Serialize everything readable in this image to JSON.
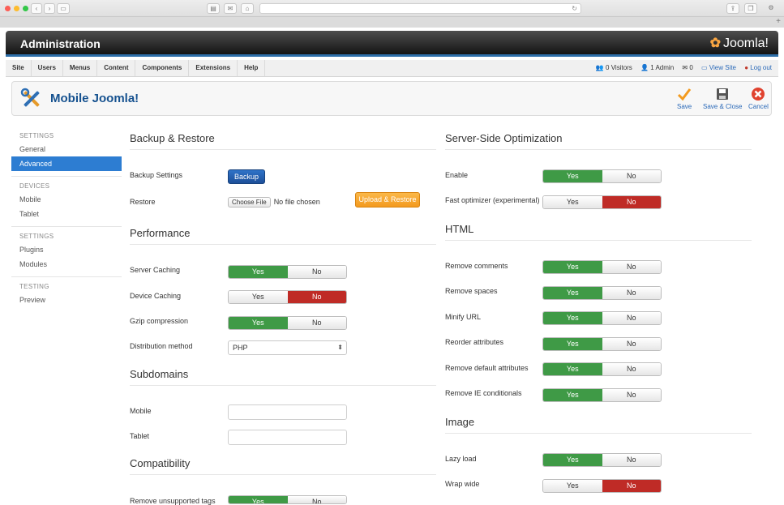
{
  "app": {
    "admin_title": "Administration",
    "logo_text": "Joomla!"
  },
  "menu": [
    "Site",
    "Users",
    "Menus",
    "Content",
    "Components",
    "Extensions",
    "Help"
  ],
  "status": {
    "visitors": "0 Visitors",
    "admins": "1 Admin",
    "messages": "0",
    "view_site": "View Site",
    "logout": "Log out"
  },
  "toolbar": {
    "title": "Mobile Joomla!",
    "save": "Save",
    "save_close": "Save & Close",
    "cancel": "Cancel"
  },
  "sidebar": [
    {
      "header": "SETTINGS",
      "items": [
        "General",
        "Advanced"
      ]
    },
    {
      "header": "DEVICES",
      "items": [
        "Mobile",
        "Tablet"
      ]
    },
    {
      "header": "SETTINGS",
      "items": [
        "Plugins",
        "Modules"
      ]
    },
    {
      "header": "TESTING",
      "items": [
        "Preview"
      ]
    }
  ],
  "sidebar_active": "Advanced",
  "backup": {
    "title": "Backup & Restore",
    "settings_label": "Backup Settings",
    "backup_btn": "Backup",
    "restore_label": "Restore",
    "choose_file": "Choose File",
    "no_file": "No file chosen",
    "upload_btn": "Upload & Restore"
  },
  "performance": {
    "title": "Performance",
    "server_caching": "Server Caching",
    "device_caching": "Device Caching",
    "gzip": "Gzip compression",
    "distribution": "Distribution method",
    "distribution_value": "PHP"
  },
  "subdomains": {
    "title": "Subdomains",
    "mobile": "Mobile",
    "tablet": "Tablet"
  },
  "compatibility": {
    "title": "Compatibility",
    "remove_tags": "Remove unsupported tags"
  },
  "sso": {
    "title": "Server-Side Optimization",
    "enable": "Enable",
    "fast": "Fast optimizer (experimental)"
  },
  "html": {
    "title": "HTML",
    "comments": "Remove comments",
    "spaces": "Remove spaces",
    "minify": "Minify URL",
    "reorder": "Reorder attributes",
    "defaults": "Remove default attributes",
    "ie": "Remove IE conditionals"
  },
  "image": {
    "title": "Image",
    "lazy": "Lazy load",
    "wrap": "Wrap wide"
  },
  "yes": "Yes",
  "no": "No",
  "toggles": {
    "server_caching": "yes",
    "device_caching": "no",
    "gzip": "yes",
    "remove_tags": "yes",
    "enable": "yes",
    "fast": "no",
    "comments": "yes",
    "spaces": "yes",
    "minify": "yes",
    "reorder": "yes",
    "defaults": "yes",
    "ie": "yes",
    "lazy": "yes",
    "wrap": "no"
  },
  "colors": {
    "accent": "#2d7dd2",
    "yes": "#3f9a46",
    "no": "#bf2b26",
    "orange": "#f39a1e"
  }
}
